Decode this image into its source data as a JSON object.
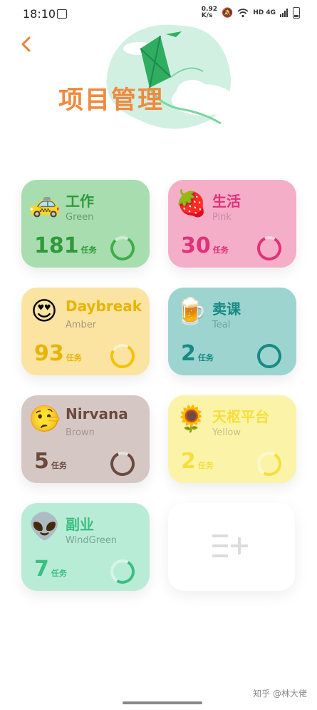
{
  "status_bar": {
    "time": "18:10",
    "speed": "0.92\nK/s",
    "network": "HD 4G"
  },
  "header": {
    "back_icon": "chevron-left-icon",
    "title": "项目管理"
  },
  "projects": [
    {
      "name": "工作",
      "color_name": "Green",
      "count": "181",
      "unit": "任务",
      "emoji": "🚕",
      "bg": "#a8ddb0",
      "title_color": "#2e9a3a",
      "count_color": "#2e9a3a",
      "sub_color": "#6a9d72",
      "ring_color": "#3fae4a",
      "progress": 0.8
    },
    {
      "name": "生活",
      "color_name": "Pink",
      "count": "30",
      "unit": "任务",
      "emoji": "🍓",
      "bg": "#f4aec7",
      "title_color": "#e0317a",
      "count_color": "#e0317a",
      "sub_color": "#c78aa2",
      "ring_color": "#e0317a",
      "progress": 0.85
    },
    {
      "name": "Daybreak",
      "color_name": "Amber",
      "count": "93",
      "unit": "任务",
      "emoji": "😍",
      "bg": "#fbe3a1",
      "title_color": "#e8b400",
      "count_color": "#e8b400",
      "sub_color": "#a8987a",
      "ring_color": "#f2c200",
      "progress": 0.75
    },
    {
      "name": "卖课",
      "color_name": "Teal",
      "count": "2",
      "unit": "任务",
      "emoji": "🍺",
      "bg": "#9ed4d0",
      "title_color": "#168a84",
      "count_color": "#168a84",
      "sub_color": "#6fa3a0",
      "ring_color": "#168a84",
      "progress": 1.0
    },
    {
      "name": "Nirvana",
      "color_name": "Brown",
      "count": "5",
      "unit": "任务",
      "emoji": "🤥",
      "bg": "#d5c8c4",
      "title_color": "#6b4a3e",
      "count_color": "#6b4a3e",
      "sub_color": "#a19691",
      "ring_color": "#6b4a3e",
      "progress": 0.85
    },
    {
      "name": "天枢平台",
      "color_name": "Yellow",
      "count": "2",
      "unit": "任务",
      "emoji": "🌻",
      "bg": "#fbf3a8",
      "title_color": "#f5df3c",
      "count_color": "#f5df3c",
      "sub_color": "#c9c08a",
      "ring_color": "#f5df3c",
      "progress": 0.5
    },
    {
      "name": "副业",
      "color_name": "WindGreen",
      "count": "7",
      "unit": "任务",
      "emoji": "👽",
      "bg": "#b9ecd6",
      "title_color": "#3abf82",
      "count_color": "#3abf82",
      "sub_color": "#7aa595",
      "ring_color": "#3abf82",
      "progress": 0.5
    }
  ],
  "add_card": {
    "icon": "add-list-icon"
  },
  "watermark": "知乎 @林大佬"
}
